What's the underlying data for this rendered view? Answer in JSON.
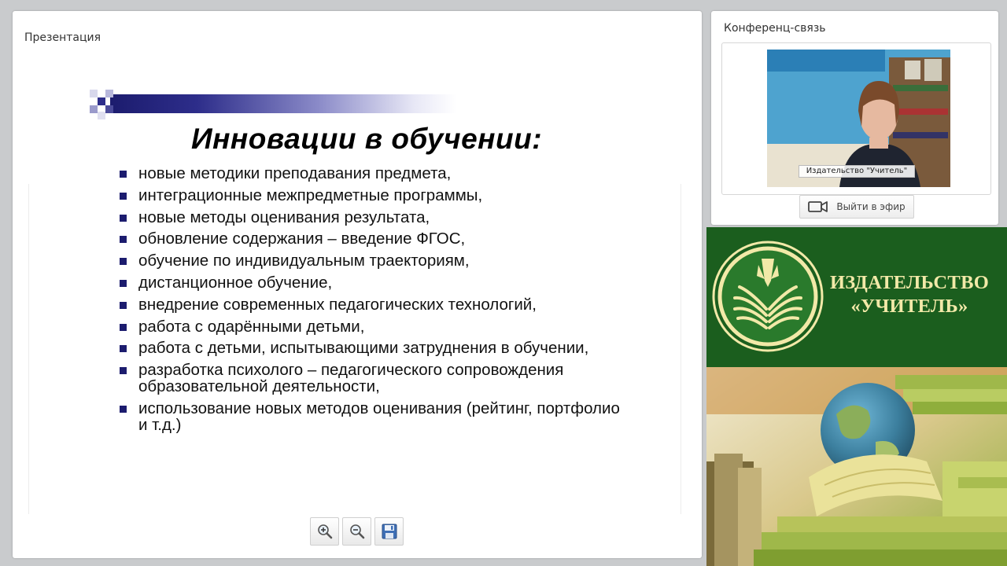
{
  "presentation": {
    "panel_title": "Презентация",
    "slide": {
      "title": "Инновации в обучении:",
      "bullets": [
        "новые методики преподавания предмета,",
        "интеграционные межпредметные программы,",
        "новые методы оценивания результата,",
        "обновление содержания – введение ФГОС,",
        "обучение по индивидуальным траекториям,",
        "дистанционное обучение,",
        "внедрение современных педагогических технологий,",
        "работа с одарёнными детьми,",
        "работа с детьми, испытывающими затруднения в обучении,",
        "разработка психолого – педагогического сопровождения образовательной деятельности,",
        "использование новых методов оценивания (рейтинг, портфолио и т.д.)"
      ]
    },
    "toolbar": {
      "zoom_in_icon": "zoom-in-icon",
      "zoom_out_icon": "zoom-out-icon",
      "save_icon": "save-icon"
    }
  },
  "conference": {
    "panel_title": "Конференц-связь",
    "video": {
      "speaker_label": "Издательство \"Учитель\""
    },
    "go_live_button": "Выйти в эфир"
  },
  "banner": {
    "publisher_line1": "ИЗДАТЕЛЬСТВО",
    "publisher_line2": "«УЧИТЕЛЬ»",
    "colors": {
      "green": "#1b5e1e",
      "gold": "#f2e9a8"
    }
  }
}
